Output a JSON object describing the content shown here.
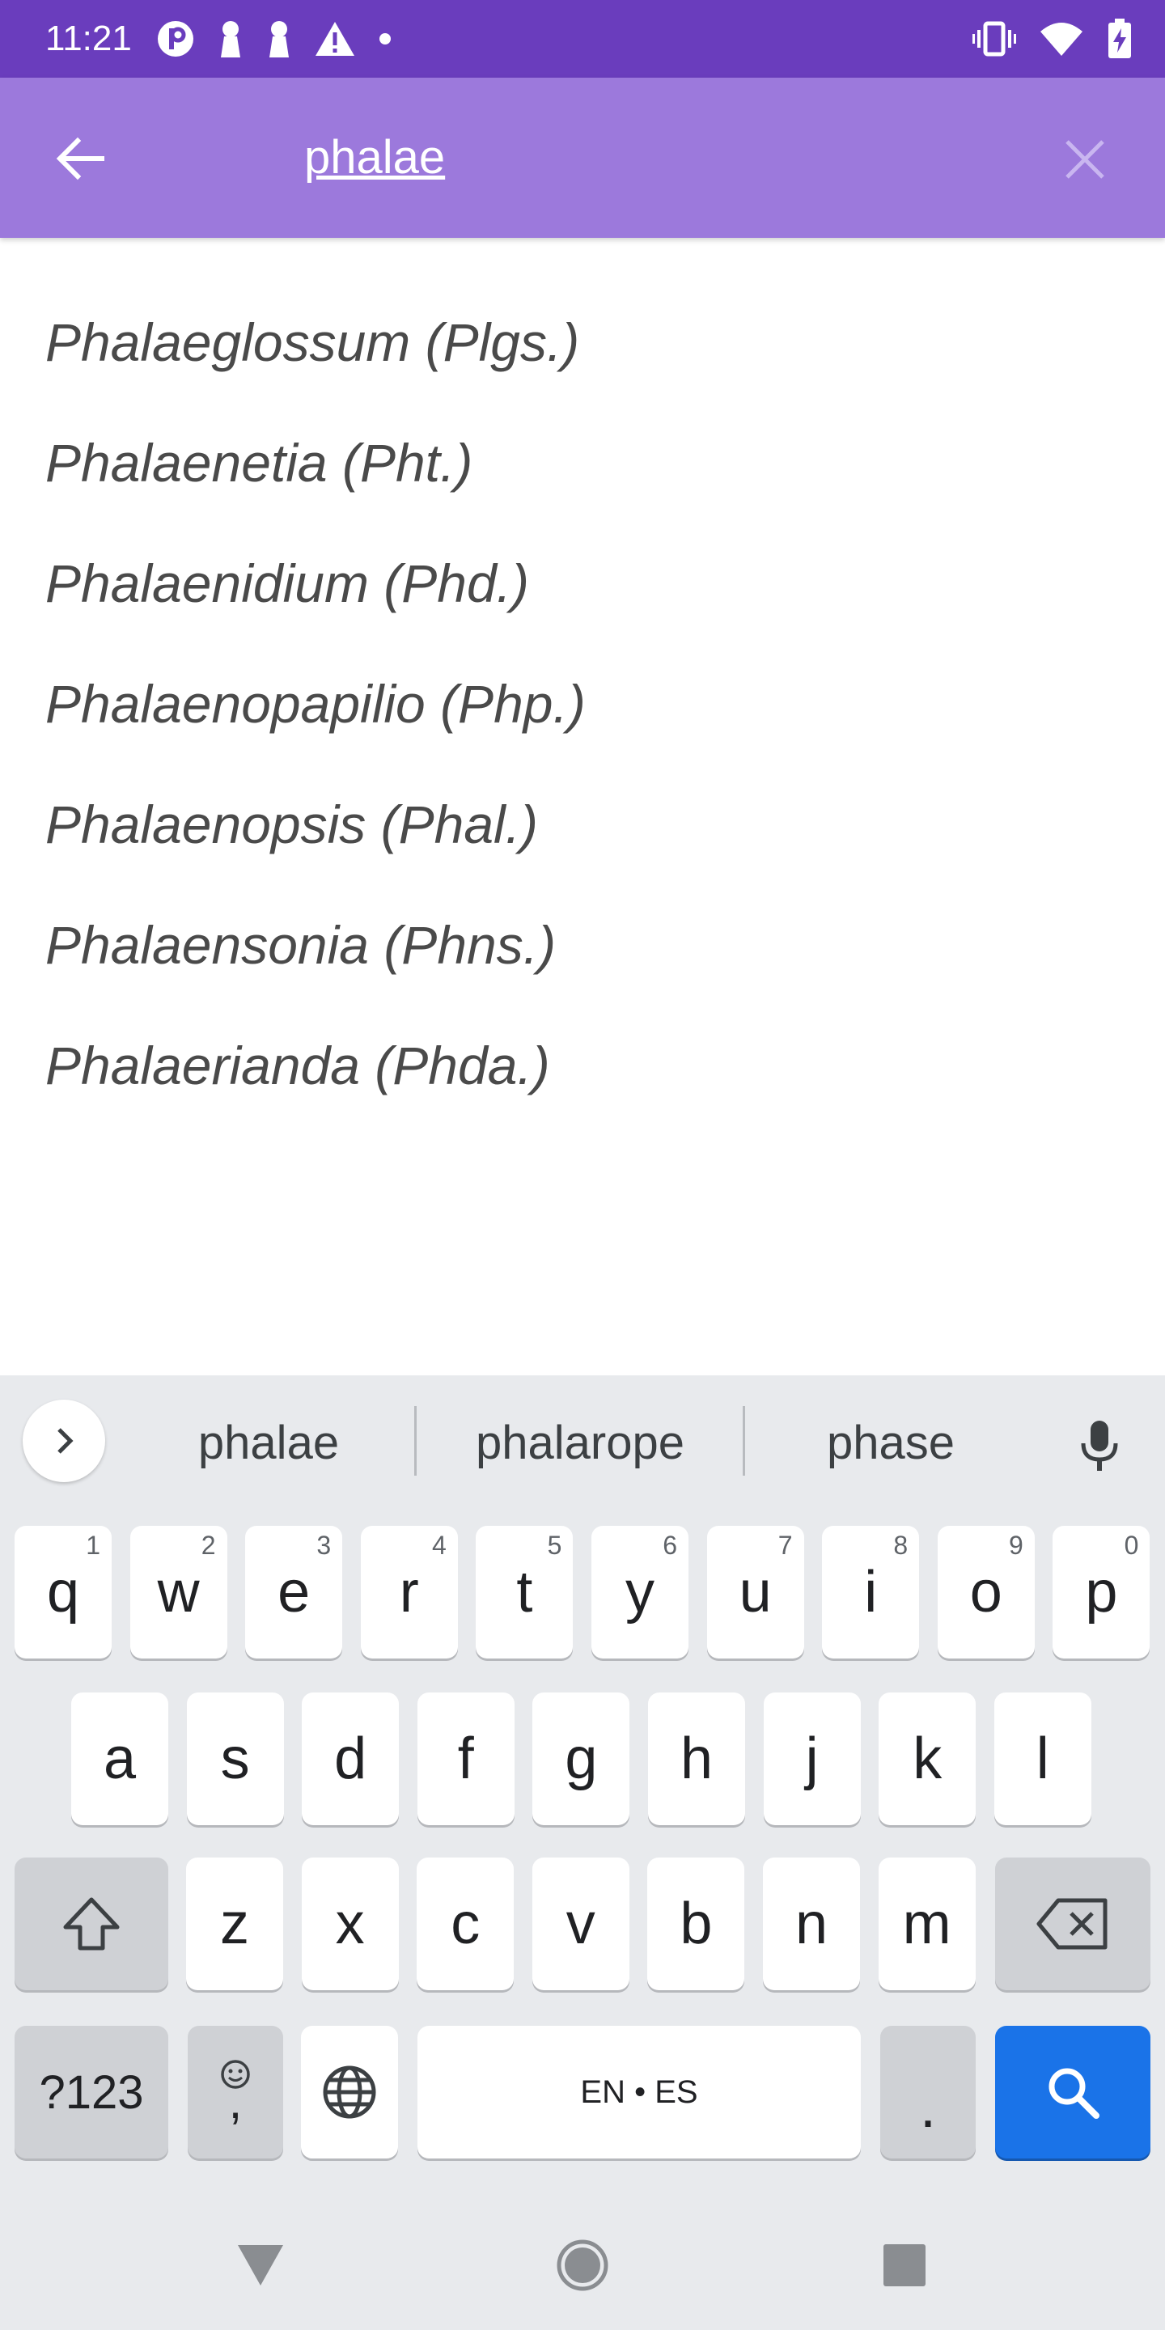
{
  "status_bar": {
    "time": "11:21",
    "left_icons": [
      "p-circle-icon",
      "keyhole-icon",
      "keyhole-icon",
      "warning-icon",
      "dot-icon"
    ],
    "right_icons": [
      "vibrate-icon",
      "wifi-icon",
      "battery-charging-icon"
    ]
  },
  "app_bar": {
    "query": "phalae",
    "background": "#9c79dc",
    "status_color": "#6a3dbd"
  },
  "results": [
    "Phalaeglossum (Plgs.)",
    "Phalaenetia (Pht.)",
    "Phalaenidium (Phd.)",
    "Phalaenopapilio (Php.)",
    "Phalaenopsis (Phal.)",
    "Phalaensonia (Phns.)",
    "Phalaerianda (Phda.)"
  ],
  "keyboard": {
    "suggestions": [
      "phalae",
      "phalarope",
      "phase"
    ],
    "row1": [
      {
        "k": "q",
        "h": "1"
      },
      {
        "k": "w",
        "h": "2"
      },
      {
        "k": "e",
        "h": "3"
      },
      {
        "k": "r",
        "h": "4"
      },
      {
        "k": "t",
        "h": "5"
      },
      {
        "k": "y",
        "h": "6"
      },
      {
        "k": "u",
        "h": "7"
      },
      {
        "k": "i",
        "h": "8"
      },
      {
        "k": "o",
        "h": "9"
      },
      {
        "k": "p",
        "h": "0"
      }
    ],
    "row2": [
      "a",
      "s",
      "d",
      "f",
      "g",
      "h",
      "j",
      "k",
      "l"
    ],
    "row3": [
      "z",
      "x",
      "c",
      "v",
      "b",
      "n",
      "m"
    ],
    "symbols_label": "?123",
    "comma_label": ",",
    "space_label": "EN • ES",
    "period_label": ".",
    "accent": "#1a73e8"
  }
}
